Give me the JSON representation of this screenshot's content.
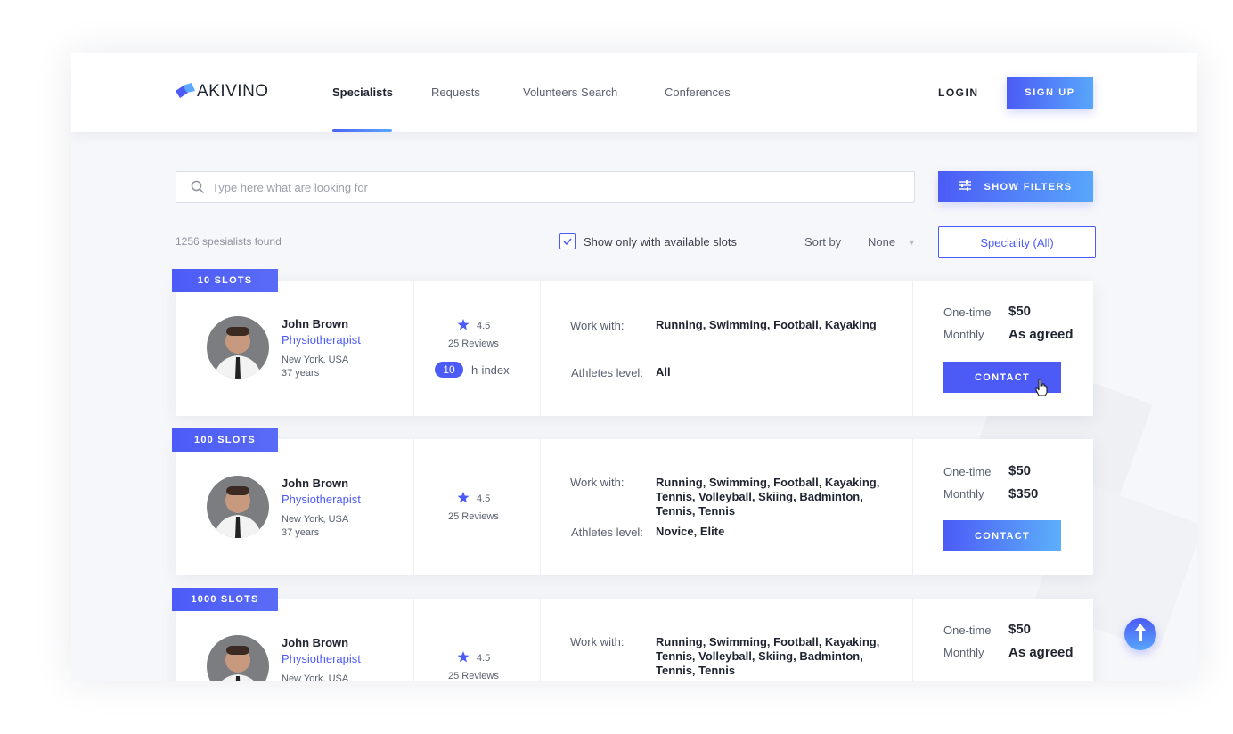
{
  "brand": {
    "name": "AKIVINO"
  },
  "nav": {
    "items": [
      {
        "label": "Specialists"
      },
      {
        "label": "Requests"
      },
      {
        "label": "Volunteers Search"
      },
      {
        "label": "Conferences"
      }
    ],
    "login_label": "LOGIN",
    "signup_label": "SIGN UP"
  },
  "search": {
    "placeholder": "Type here what are looking for"
  },
  "filters_button": "SHOW FILTERS",
  "results_count": "1256 spesialists found",
  "available_slots": {
    "label": "Show only with available slots",
    "checked": true
  },
  "sort": {
    "label": "Sort by",
    "value": "None"
  },
  "speciality_button": "Speciality (All)",
  "cards": [
    {
      "slots": "10 SLOTS",
      "name": "John Brown",
      "role": "Physiotherapist",
      "location": "New York, USA",
      "age": "37 years",
      "rating": "4.5",
      "reviews": "25 Reviews",
      "h_index_value": "10",
      "h_index_label": "h-index",
      "work_with_label": "Work with:",
      "work_with": "Running, Swimming, Football, Kayaking",
      "athletes_label": "Athletes level:",
      "athletes": "All",
      "onetime_label": "One-time",
      "onetime_price": "$50",
      "monthly_label": "Monthly",
      "monthly_price": "As agreed",
      "contact_label": "CONTACT"
    },
    {
      "slots": "100 SLOTS",
      "name": "John Brown",
      "role": "Physiotherapist",
      "location": "New York, USA",
      "age": "37 years",
      "rating": "4.5",
      "reviews": "25 Reviews",
      "work_with_label": "Work with:",
      "work_with_lines": [
        "Running, Swimming, Football, Kayaking,",
        "Tennis, Volleyball, Skiing, Badminton,",
        "Tennis, Tennis"
      ],
      "athletes_label": "Athletes level:",
      "athletes": "Novice, Elite",
      "onetime_label": "One-time",
      "onetime_price": "$50",
      "monthly_label": "Monthly",
      "monthly_price": "$350",
      "contact_label": "CONTACT"
    },
    {
      "slots": "1000 SLOTS",
      "name": "John Brown",
      "role": "Physiotherapist",
      "location": "New York, USA",
      "rating": "4.5",
      "reviews": "25 Reviews",
      "work_with_label": "Work with:",
      "work_with_lines": [
        "Running, Swimming, Football, Kayaking,",
        "Tennis, Volleyball, Skiing, Badminton,",
        "Tennis, Tennis"
      ],
      "onetime_label": "One-time",
      "onetime_price": "$50",
      "monthly_label": "Monthly",
      "monthly_price": "As agreed"
    }
  ],
  "colors": {
    "accent": "#4c5bf6",
    "accent_light": "#58a6fb"
  },
  "icons": {
    "search": "search-icon",
    "filters": "sliders-icon",
    "star": "star-icon",
    "check": "check-icon",
    "scroll_top": "arrow-up-icon",
    "cursor": "hand-cursor-icon"
  }
}
